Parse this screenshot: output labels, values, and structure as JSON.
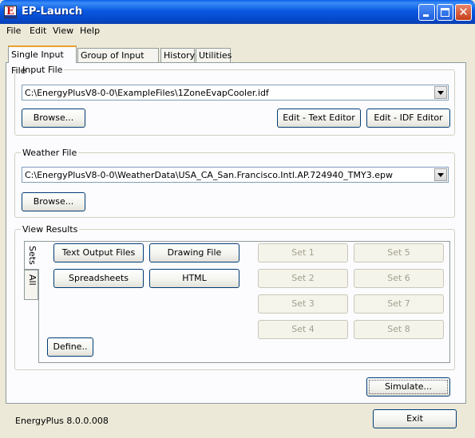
{
  "window": {
    "title": "EP-Launch",
    "app_icon_letter": "E"
  },
  "menu": [
    "File",
    "Edit",
    "View",
    "Help"
  ],
  "tabs": [
    "Single Input File",
    "Group of Input Files",
    "History",
    "Utilities"
  ],
  "input_file": {
    "label": "Input File",
    "path": "C:\\EnergyPlusV8-0-0\\ExampleFiles\\1ZoneEvapCooler.idf",
    "browse_label": "Browse...",
    "edit_text_label": "Edit - Text Editor",
    "edit_idf_label": "Edit - IDF Editor"
  },
  "weather_file": {
    "label": "Weather File",
    "path": "C:\\EnergyPlusV8-0-0\\WeatherData\\USA_CA_San.Francisco.Intl.AP.724940_TMY3.epw",
    "browse_label": "Browse..."
  },
  "view_results": {
    "label": "View Results",
    "side_tabs": [
      "Sets",
      "All"
    ],
    "text_output_label": "Text Output Files",
    "drawing_label": "Drawing File",
    "spreadsheets_label": "Spreadsheets",
    "html_label": "HTML",
    "sets": [
      "Set 1",
      "Set 2",
      "Set 3",
      "Set 4",
      "Set 5",
      "Set 6",
      "Set 7",
      "Set 8"
    ],
    "define_label": "Define.."
  },
  "simulate_label": "Simulate...",
  "exit_label": "Exit",
  "version": "EnergyPlus 8.0.0.008"
}
